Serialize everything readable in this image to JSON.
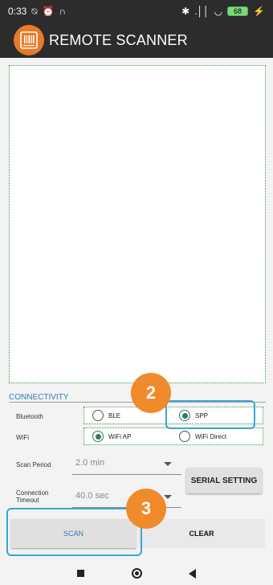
{
  "status_bar": {
    "time": "0:33",
    "left_icons": [
      "⍉",
      "⏰",
      "∩"
    ],
    "right_icons": [
      "✱",
      ".││",
      "◡"
    ],
    "battery": "68",
    "charging": "⚡"
  },
  "app_bar": {
    "title": "REMOTE SCANNER"
  },
  "connectivity": {
    "section_label": "CONNECTIVITY",
    "bluetooth": {
      "label": "Bluetooth",
      "options": [
        "BLE",
        "SPP"
      ],
      "selected": "SPP"
    },
    "wifi": {
      "label": "WiFi",
      "options": [
        "WiFi AP",
        "WiFi Direct"
      ],
      "selected": "WiFi AP"
    },
    "scan_period": {
      "label": "Scan Period",
      "value": "2.0 min"
    },
    "connection_timeout": {
      "label": "Connection Timeout",
      "value": "40.0 sec"
    },
    "serial_setting_label": "SERIAL SETTING"
  },
  "actions": {
    "scan_label": "SCAN",
    "clear_label": "CLEAR"
  },
  "annotations": {
    "badge_2": "2",
    "badge_3": "3"
  },
  "colors": {
    "accent": "#2a7db1",
    "badge": "#f08a2b",
    "highlight": "#3aa6d8",
    "radio": "#2e7d5b"
  }
}
